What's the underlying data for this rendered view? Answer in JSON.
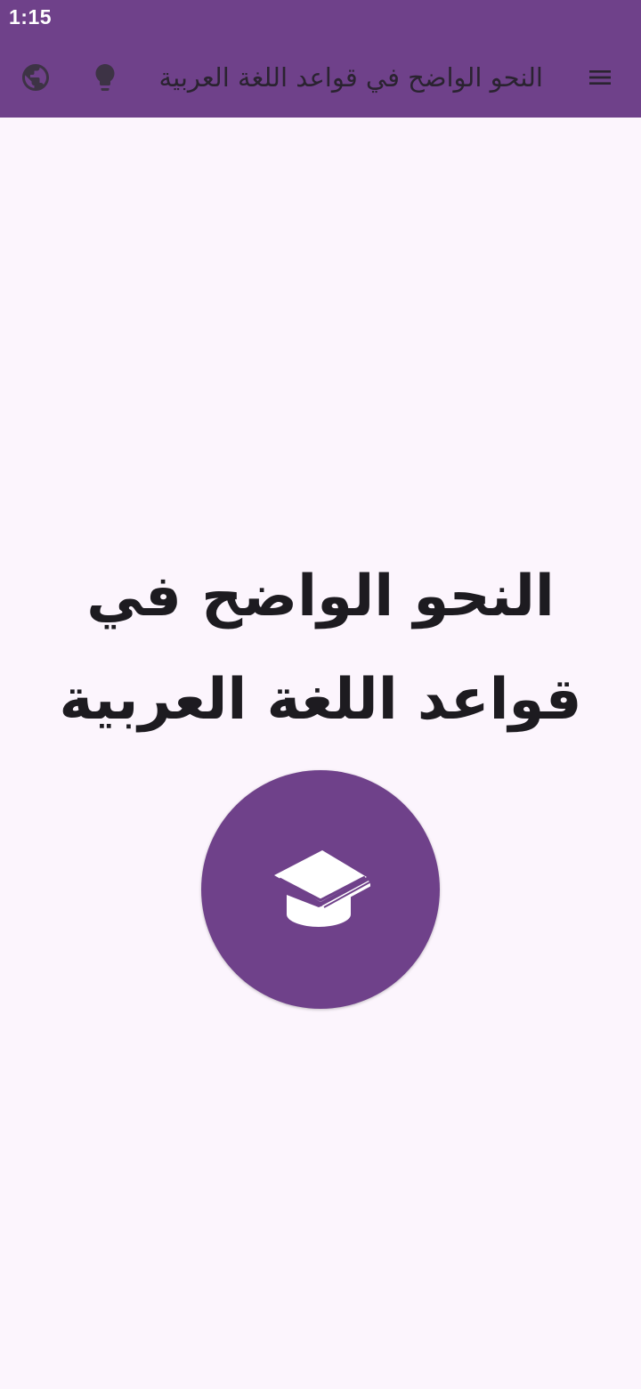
{
  "status_bar": {
    "time": "1:15"
  },
  "app_bar": {
    "title": "النحو الواضح في قواعد اللغة العربية",
    "icons": {
      "left_1": "globe-icon",
      "left_2": "lightbulb-icon",
      "right": "menu-icon"
    }
  },
  "main": {
    "heading": "النحو الواضح في قواعد اللغة العربية",
    "logo_icon": "graduation-cap-book-icon"
  },
  "colors": {
    "primary": "#6f418a",
    "background": "#fcf5fd",
    "text": "#1d1b20",
    "icon_dark": "#3d3345"
  }
}
